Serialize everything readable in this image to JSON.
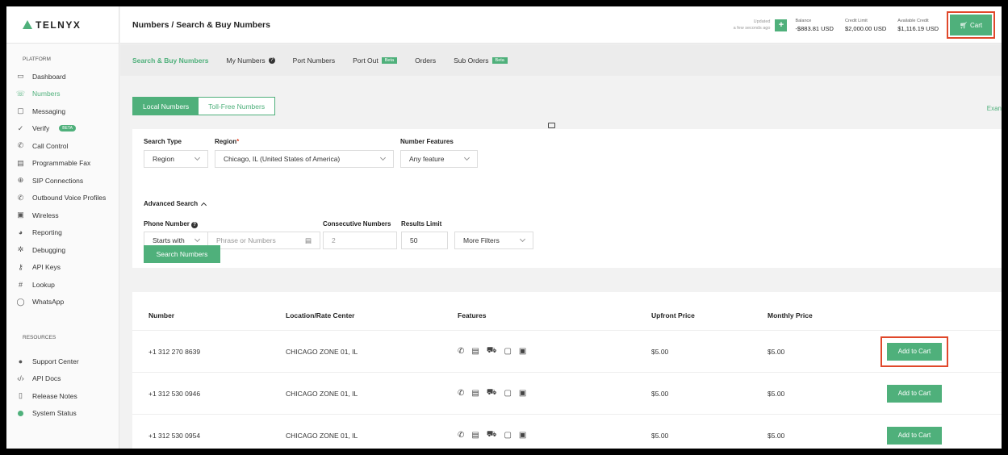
{
  "logo": {
    "text": "TELNYX"
  },
  "header": {
    "breadcrumb": "Numbers / Search & Buy Numbers",
    "updated_line1": "Updated",
    "updated_line2": "a few seconds ago",
    "add_credit": "+",
    "balance_label": "Balance",
    "balance_value": "-$883.81 USD",
    "credit_limit_label": "Credit Limit",
    "credit_limit_value": "$2,000.00 USD",
    "available_label": "Available Credit",
    "available_value": "$1,116.19 USD",
    "cart_label": "Cart"
  },
  "sidebar": {
    "platform_heading": "PLATFORM",
    "items": [
      {
        "label": "Dashboard",
        "icon": "dashboard-icon"
      },
      {
        "label": "Numbers",
        "icon": "numbers-icon"
      },
      {
        "label": "Messaging",
        "icon": "message-icon"
      },
      {
        "label": "Verify",
        "icon": "verify-icon",
        "badge": "BETA"
      },
      {
        "label": "Call Control",
        "icon": "phone-icon"
      },
      {
        "label": "Programmable Fax",
        "icon": "fax-icon"
      },
      {
        "label": "SIP Connections",
        "icon": "sip-icon"
      },
      {
        "label": "Outbound Voice Profiles",
        "icon": "outbound-call-icon"
      },
      {
        "label": "Wireless",
        "icon": "sim-icon"
      },
      {
        "label": "Reporting",
        "icon": "chart-icon"
      },
      {
        "label": "Debugging",
        "icon": "bug-icon"
      },
      {
        "label": "API Keys",
        "icon": "key-icon"
      },
      {
        "label": "Lookup",
        "icon": "hash-icon"
      },
      {
        "label": "WhatsApp",
        "icon": "whatsapp-icon"
      }
    ],
    "resources_heading": "RESOURCES",
    "resources": [
      {
        "label": "Support Center",
        "icon": "help-icon"
      },
      {
        "label": "API Docs",
        "icon": "code-icon"
      },
      {
        "label": "Release Notes",
        "icon": "document-icon"
      },
      {
        "label": "System Status",
        "icon": "status-dot-icon"
      }
    ]
  },
  "tabs": [
    {
      "label": "Search & Buy Numbers"
    },
    {
      "label": "My Numbers"
    },
    {
      "label": "Port Numbers"
    },
    {
      "label": "Port Out",
      "badge": "Beta"
    },
    {
      "label": "Orders"
    },
    {
      "label": "Sub Orders",
      "badge": "Beta"
    }
  ],
  "number_type": {
    "local": "Local Numbers",
    "toll_free": "Toll-Free Numbers"
  },
  "exam_link": "Exan",
  "search": {
    "search_type_label": "Search Type",
    "search_type_value": "Region",
    "region_label": "Region",
    "region_required": "*",
    "region_value": "Chicago, IL (United States of America)",
    "features_label": "Number Features",
    "features_value": "Any feature",
    "advanced_label": "Advanced Search",
    "phone_label": "Phone Number",
    "phone_mode": "Starts with",
    "phone_placeholder": "Phrase or Numbers",
    "consecutive_label": "Consecutive Numbers",
    "consecutive_value": "2",
    "limit_label": "Results Limit",
    "limit_value": "50",
    "more_filters": "More Filters",
    "search_button": "Search Numbers"
  },
  "results": {
    "columns": [
      "Number",
      "Location/Rate Center",
      "Features",
      "Upfront Price",
      "Monthly Price"
    ],
    "rows": [
      {
        "number": "+1 312 270 8639",
        "location": "CHICAGO ZONE 01, IL",
        "upfront": "$5.00",
        "monthly": "$5.00",
        "action": "Add to Cart"
      },
      {
        "number": "+1 312 530 0946",
        "location": "CHICAGO ZONE 01, IL",
        "upfront": "$5.00",
        "monthly": "$5.00",
        "action": "Add to Cart"
      },
      {
        "number": "+1 312 530 0954",
        "location": "CHICAGO ZONE 01, IL",
        "upfront": "$5.00",
        "monthly": "$5.00",
        "action": "Add to Cart"
      }
    ]
  },
  "colors": {
    "accent": "#4fb07b",
    "highlight": "#e0482b"
  }
}
